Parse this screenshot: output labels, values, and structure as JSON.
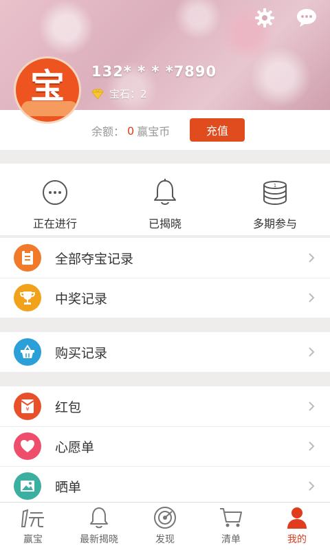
{
  "header": {
    "phone": "132* *  * *7890",
    "gem_label": "宝石：2",
    "avatar_char": "宝",
    "balance_prefix": "余额：",
    "balance_amount": "0",
    "balance_unit": "赢宝币",
    "recharge_label": "充值",
    "icons": {
      "settings": "gear-icon",
      "message": "chat-bubble-icon"
    }
  },
  "quick": [
    {
      "label": "正在进行",
      "icon": "ellipsis-circle-icon"
    },
    {
      "label": "已揭晓",
      "icon": "bell-icon"
    },
    {
      "label": "多期参与",
      "icon": "coin-stack-icon"
    }
  ],
  "groups": [
    [
      {
        "label": "全部夺宝记录",
        "icon": "record-icon",
        "color": "#f07a2a"
      },
      {
        "label": "中奖记录",
        "icon": "trophy-icon",
        "color": "#f2a21a"
      }
    ],
    [
      {
        "label": "购买记录",
        "icon": "basket-icon",
        "color": "#2a9fd8"
      }
    ],
    [
      {
        "label": "红包",
        "icon": "red-envelope-icon",
        "color": "#e8502a"
      },
      {
        "label": "心愿单",
        "icon": "heart-icon",
        "color": "#ee4d6b"
      },
      {
        "label": "晒单",
        "icon": "photo-icon",
        "color": "#3cb0a0"
      }
    ]
  ],
  "tabs": [
    {
      "label": "赢宝",
      "icon": "yiyuan-icon",
      "active": false
    },
    {
      "label": "最新揭晓",
      "icon": "bell-icon",
      "active": false
    },
    {
      "label": "发现",
      "icon": "radar-icon",
      "active": false
    },
    {
      "label": "清单",
      "icon": "cart-icon",
      "active": false
    },
    {
      "label": "我的",
      "icon": "person-icon",
      "active": true
    }
  ],
  "colors": {
    "accent": "#e04c1e",
    "active_tab": "#e03c1e"
  }
}
